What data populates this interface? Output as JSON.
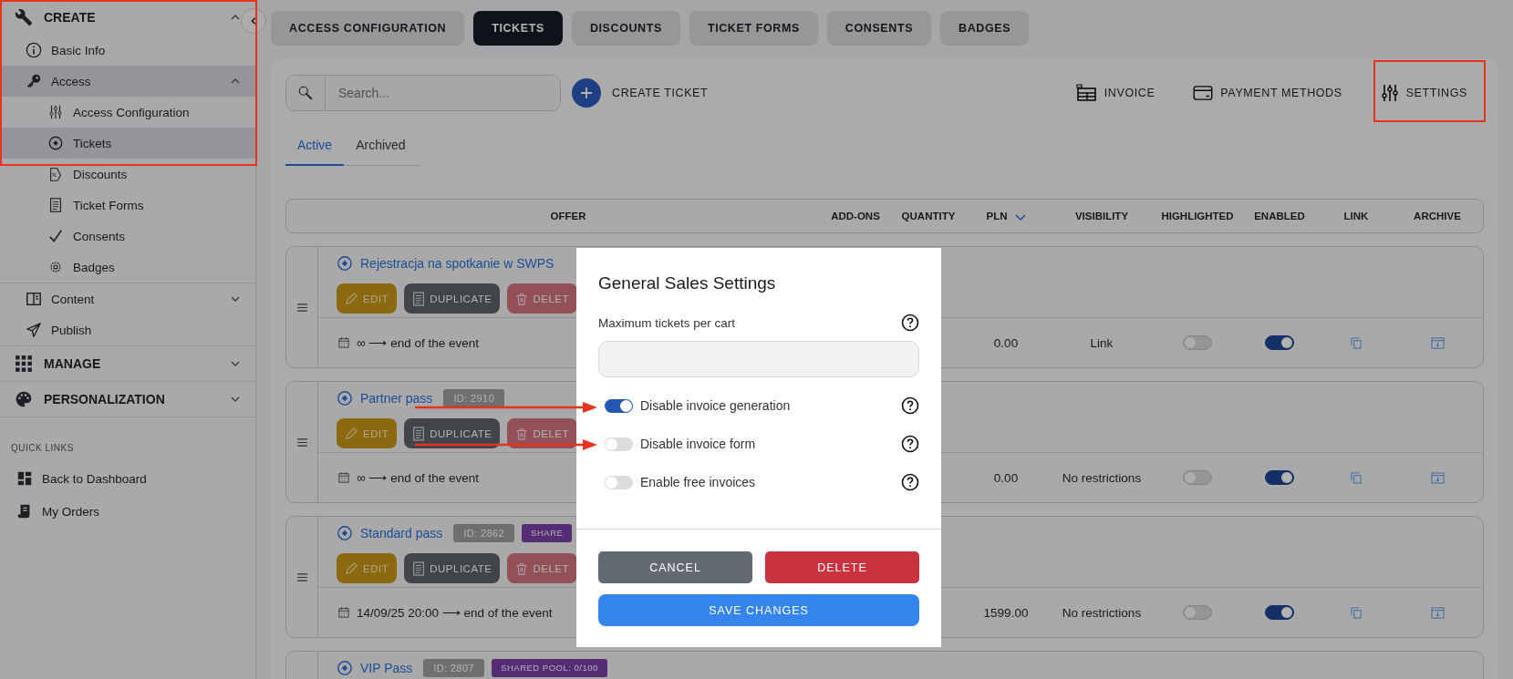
{
  "sidebar": {
    "sections": [
      {
        "label": "CREATE",
        "expanded": true,
        "items": [
          {
            "label": "Basic Info",
            "selected": false
          },
          {
            "label": "Access",
            "selected": true,
            "expanded": true,
            "children": [
              {
                "label": "Access Configuration",
                "selected": false
              },
              {
                "label": "Tickets",
                "selected": true
              },
              {
                "label": "Discounts",
                "selected": false
              },
              {
                "label": "Ticket Forms",
                "selected": false
              },
              {
                "label": "Consents",
                "selected": false
              },
              {
                "label": "Badges",
                "selected": false
              }
            ]
          },
          {
            "label": "Content",
            "selected": false,
            "expanded": false
          },
          {
            "label": "Publish",
            "selected": false
          }
        ]
      },
      {
        "label": "MANAGE",
        "expanded": false
      },
      {
        "label": "PERSONALIZATION",
        "expanded": false
      }
    ],
    "quick_links": {
      "title": "QUICK LINKS",
      "items": [
        {
          "label": "Back to Dashboard"
        },
        {
          "label": "My Orders"
        }
      ]
    }
  },
  "tabs": [
    {
      "label": "ACCESS CONFIGURATION",
      "selected": false
    },
    {
      "label": "TICKETS",
      "selected": true
    },
    {
      "label": "DISCOUNTS",
      "selected": false
    },
    {
      "label": "TICKET FORMS",
      "selected": false
    },
    {
      "label": "CONSENTS",
      "selected": false
    },
    {
      "label": "BADGES",
      "selected": false
    }
  ],
  "toolbar": {
    "search": {
      "placeholder": "Search..."
    },
    "create_button": "CREATE TICKET",
    "actions": [
      "INVOICE",
      "PAYMENT METHODS",
      "SETTINGS"
    ]
  },
  "subtabs": [
    {
      "label": "Active",
      "selected": true
    },
    {
      "label": "Archived",
      "selected": false
    }
  ],
  "table": {
    "columns": [
      {
        "label": "OFFER",
        "sorted": false
      },
      {
        "label": "ADD-ONS",
        "sorted": false
      },
      {
        "label": "QUANTITY",
        "sorted": false
      },
      {
        "label": "PLN",
        "sorted": true
      },
      {
        "label": "VISIBILITY",
        "sorted": false
      },
      {
        "label": "HIGHLIGHTED",
        "sorted": false
      },
      {
        "label": "ENABLED",
        "sorted": false
      },
      {
        "label": "LINK",
        "sorted": false
      },
      {
        "label": "ARCHIVE",
        "sorted": false
      }
    ],
    "rows": [
      {
        "name": "Rejestracja na spotkanie w SWPS",
        "actions": [
          "EDIT",
          "DUPLICATE",
          "DELET"
        ],
        "date": "∞ ⟶ end of the event",
        "price": "0.00",
        "visibility": "Link",
        "highlighted": false,
        "enabled": true
      },
      {
        "name": "Partner pass",
        "id": "ID: 2910",
        "actions": [
          "EDIT",
          "DUPLICATE",
          "DELET"
        ],
        "date": "∞ ⟶ end of the event",
        "price": "0.00",
        "visibility": "No restrictions",
        "highlighted": false,
        "enabled": true
      },
      {
        "name": "Standard pass",
        "id": "ID: 2862",
        "pool": "SHARE",
        "actions": [
          "EDIT",
          "DUPLICATE",
          "DELET"
        ],
        "date": "14/09/25 20:00 ⟶ end of the event",
        "price": "1599.00",
        "visibility": "No restrictions",
        "highlighted": false,
        "enabled": true
      },
      {
        "name": "VIP Pass",
        "id": "ID: 2807",
        "pool": "SHARED POOL: 0/100"
      }
    ]
  },
  "modal": {
    "title": "General Sales Settings",
    "field": {
      "label": "Maximum tickets per cart"
    },
    "toggles": [
      {
        "label": "Disable invoice generation",
        "on": true
      },
      {
        "label": "Disable invoice form",
        "on": false
      },
      {
        "label": "Enable free invoices",
        "on": false
      }
    ],
    "buttons": [
      {
        "kind": "cancel",
        "label": "CANCEL"
      },
      {
        "kind": "delete",
        "label": "DELETE"
      },
      {
        "kind": "save",
        "label": "SAVE CHANGES"
      }
    ]
  }
}
